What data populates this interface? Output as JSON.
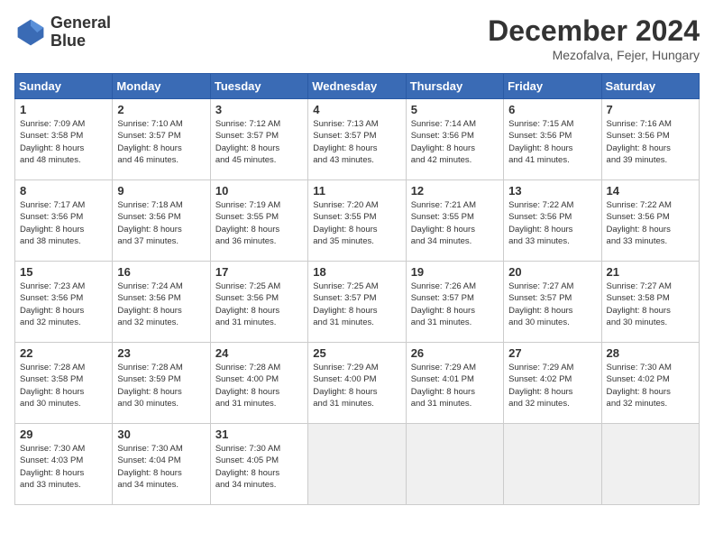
{
  "header": {
    "logo_line1": "General",
    "logo_line2": "Blue",
    "month": "December 2024",
    "location": "Mezofalva, Fejer, Hungary"
  },
  "days_of_week": [
    "Sunday",
    "Monday",
    "Tuesday",
    "Wednesday",
    "Thursday",
    "Friday",
    "Saturday"
  ],
  "weeks": [
    [
      {
        "day": "1",
        "lines": [
          "Sunrise: 7:09 AM",
          "Sunset: 3:58 PM",
          "Daylight: 8 hours",
          "and 48 minutes."
        ]
      },
      {
        "day": "2",
        "lines": [
          "Sunrise: 7:10 AM",
          "Sunset: 3:57 PM",
          "Daylight: 8 hours",
          "and 46 minutes."
        ]
      },
      {
        "day": "3",
        "lines": [
          "Sunrise: 7:12 AM",
          "Sunset: 3:57 PM",
          "Daylight: 8 hours",
          "and 45 minutes."
        ]
      },
      {
        "day": "4",
        "lines": [
          "Sunrise: 7:13 AM",
          "Sunset: 3:57 PM",
          "Daylight: 8 hours",
          "and 43 minutes."
        ]
      },
      {
        "day": "5",
        "lines": [
          "Sunrise: 7:14 AM",
          "Sunset: 3:56 PM",
          "Daylight: 8 hours",
          "and 42 minutes."
        ]
      },
      {
        "day": "6",
        "lines": [
          "Sunrise: 7:15 AM",
          "Sunset: 3:56 PM",
          "Daylight: 8 hours",
          "and 41 minutes."
        ]
      },
      {
        "day": "7",
        "lines": [
          "Sunrise: 7:16 AM",
          "Sunset: 3:56 PM",
          "Daylight: 8 hours",
          "and 39 minutes."
        ]
      }
    ],
    [
      {
        "day": "8",
        "lines": [
          "Sunrise: 7:17 AM",
          "Sunset: 3:56 PM",
          "Daylight: 8 hours",
          "and 38 minutes."
        ]
      },
      {
        "day": "9",
        "lines": [
          "Sunrise: 7:18 AM",
          "Sunset: 3:56 PM",
          "Daylight: 8 hours",
          "and 37 minutes."
        ]
      },
      {
        "day": "10",
        "lines": [
          "Sunrise: 7:19 AM",
          "Sunset: 3:55 PM",
          "Daylight: 8 hours",
          "and 36 minutes."
        ]
      },
      {
        "day": "11",
        "lines": [
          "Sunrise: 7:20 AM",
          "Sunset: 3:55 PM",
          "Daylight: 8 hours",
          "and 35 minutes."
        ]
      },
      {
        "day": "12",
        "lines": [
          "Sunrise: 7:21 AM",
          "Sunset: 3:55 PM",
          "Daylight: 8 hours",
          "and 34 minutes."
        ]
      },
      {
        "day": "13",
        "lines": [
          "Sunrise: 7:22 AM",
          "Sunset: 3:56 PM",
          "Daylight: 8 hours",
          "and 33 minutes."
        ]
      },
      {
        "day": "14",
        "lines": [
          "Sunrise: 7:22 AM",
          "Sunset: 3:56 PM",
          "Daylight: 8 hours",
          "and 33 minutes."
        ]
      }
    ],
    [
      {
        "day": "15",
        "lines": [
          "Sunrise: 7:23 AM",
          "Sunset: 3:56 PM",
          "Daylight: 8 hours",
          "and 32 minutes."
        ]
      },
      {
        "day": "16",
        "lines": [
          "Sunrise: 7:24 AM",
          "Sunset: 3:56 PM",
          "Daylight: 8 hours",
          "and 32 minutes."
        ]
      },
      {
        "day": "17",
        "lines": [
          "Sunrise: 7:25 AM",
          "Sunset: 3:56 PM",
          "Daylight: 8 hours",
          "and 31 minutes."
        ]
      },
      {
        "day": "18",
        "lines": [
          "Sunrise: 7:25 AM",
          "Sunset: 3:57 PM",
          "Daylight: 8 hours",
          "and 31 minutes."
        ]
      },
      {
        "day": "19",
        "lines": [
          "Sunrise: 7:26 AM",
          "Sunset: 3:57 PM",
          "Daylight: 8 hours",
          "and 31 minutes."
        ]
      },
      {
        "day": "20",
        "lines": [
          "Sunrise: 7:27 AM",
          "Sunset: 3:57 PM",
          "Daylight: 8 hours",
          "and 30 minutes."
        ]
      },
      {
        "day": "21",
        "lines": [
          "Sunrise: 7:27 AM",
          "Sunset: 3:58 PM",
          "Daylight: 8 hours",
          "and 30 minutes."
        ]
      }
    ],
    [
      {
        "day": "22",
        "lines": [
          "Sunrise: 7:28 AM",
          "Sunset: 3:58 PM",
          "Daylight: 8 hours",
          "and 30 minutes."
        ]
      },
      {
        "day": "23",
        "lines": [
          "Sunrise: 7:28 AM",
          "Sunset: 3:59 PM",
          "Daylight: 8 hours",
          "and 30 minutes."
        ]
      },
      {
        "day": "24",
        "lines": [
          "Sunrise: 7:28 AM",
          "Sunset: 4:00 PM",
          "Daylight: 8 hours",
          "and 31 minutes."
        ]
      },
      {
        "day": "25",
        "lines": [
          "Sunrise: 7:29 AM",
          "Sunset: 4:00 PM",
          "Daylight: 8 hours",
          "and 31 minutes."
        ]
      },
      {
        "day": "26",
        "lines": [
          "Sunrise: 7:29 AM",
          "Sunset: 4:01 PM",
          "Daylight: 8 hours",
          "and 31 minutes."
        ]
      },
      {
        "day": "27",
        "lines": [
          "Sunrise: 7:29 AM",
          "Sunset: 4:02 PM",
          "Daylight: 8 hours",
          "and 32 minutes."
        ]
      },
      {
        "day": "28",
        "lines": [
          "Sunrise: 7:30 AM",
          "Sunset: 4:02 PM",
          "Daylight: 8 hours",
          "and 32 minutes."
        ]
      }
    ],
    [
      {
        "day": "29",
        "lines": [
          "Sunrise: 7:30 AM",
          "Sunset: 4:03 PM",
          "Daylight: 8 hours",
          "and 33 minutes."
        ]
      },
      {
        "day": "30",
        "lines": [
          "Sunrise: 7:30 AM",
          "Sunset: 4:04 PM",
          "Daylight: 8 hours",
          "and 34 minutes."
        ]
      },
      {
        "day": "31",
        "lines": [
          "Sunrise: 7:30 AM",
          "Sunset: 4:05 PM",
          "Daylight: 8 hours",
          "and 34 minutes."
        ]
      },
      null,
      null,
      null,
      null
    ]
  ]
}
